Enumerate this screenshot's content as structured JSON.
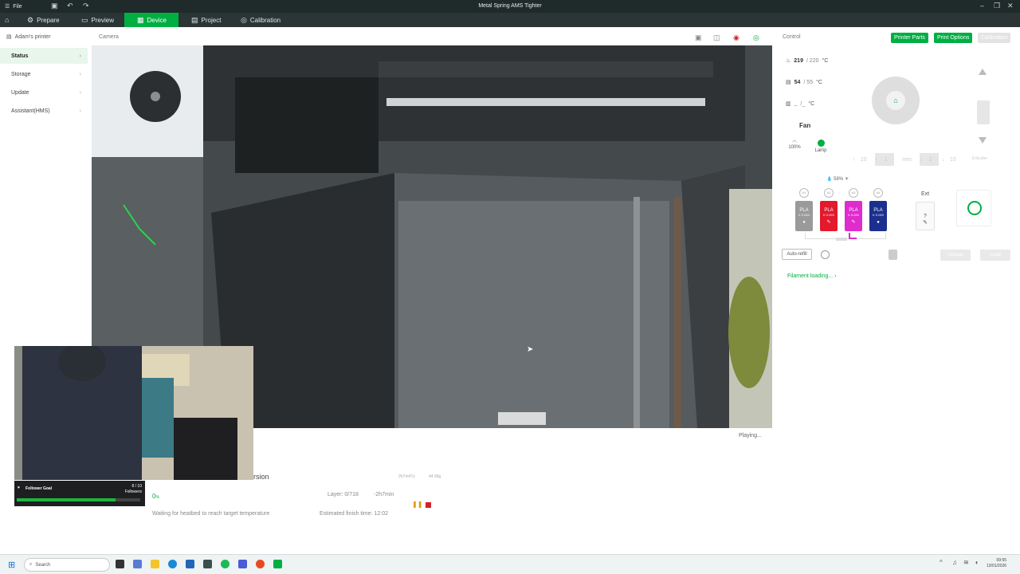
{
  "titlebar": {
    "menu": "File",
    "title": "Metal Spring AMS Tighter"
  },
  "nav": {
    "tabs": [
      {
        "label": "Prepare"
      },
      {
        "label": "Preview"
      },
      {
        "label": "Device"
      },
      {
        "label": "Project"
      },
      {
        "label": "Calibration"
      }
    ]
  },
  "sidebar": {
    "printer_name": "Adam's printer",
    "items": [
      {
        "label": "Status"
      },
      {
        "label": "Storage"
      },
      {
        "label": "Update"
      },
      {
        "label": "Assistant(HMS)"
      }
    ]
  },
  "camera": {
    "label": "Camera",
    "status": "Playing..."
  },
  "overlay": {
    "follower_goal": "Follower Goal",
    "count": "8 / 10",
    "count_label": "Followers",
    "progress": 0.8
  },
  "task": {
    "title_fragment": "rsion",
    "time_meta": "2h7m47s",
    "weight_meta": "44.99g",
    "progress_pct": "0",
    "progress_unit": "%",
    "layer": "Layer: 0/718",
    "remaining": "-2h7min",
    "status": "Waiting for heatbed to reach target temperature",
    "finish": "Estimated finish time: 12:02"
  },
  "control": {
    "label": "Control",
    "buttons": {
      "printer_parts": "Printer Parts",
      "print_options": "Print Options",
      "calibration": "Calibration"
    },
    "nozzle": {
      "value": "219",
      "target": "/ 220",
      "unit": "°C"
    },
    "bed": {
      "value": "54",
      "target": "/ 55",
      "unit": "°C"
    },
    "chamber": {
      "value": "_",
      "target": "/_",
      "unit": "°C"
    },
    "fan_title": "Fan",
    "fan_speed": "100%",
    "lamp": "Lamp",
    "extruder_label": "Extruder",
    "z_steps": [
      "10",
      "1",
      "mm",
      "1",
      "10"
    ],
    "humidity": "58",
    "humidity_unit": "%",
    "ams_slots": [
      {
        "label": "A1",
        "type": "PLA",
        "k": "K 0.020",
        "color": "#9a9a9a"
      },
      {
        "label": "A2",
        "type": "PLA",
        "k": "K 0.020",
        "color": "#e3192c"
      },
      {
        "label": "A3",
        "type": "PLA",
        "k": "K 0.020",
        "color": "#e02bcd"
      },
      {
        "label": "A4",
        "type": "PLA",
        "k": "K 0.020",
        "color": "#1b2f8e"
      }
    ],
    "ext_label": "Ext",
    "ext_value": "?",
    "auto_refill": "Auto-refill",
    "unload": "Unload",
    "load": "Load",
    "filament_loading": "Filament loading..."
  },
  "taskbar": {
    "search": "Search",
    "time": "09:55",
    "date": "13/01/2026"
  },
  "colors": {
    "accent": "#00ae42",
    "nav_bg": "#2b3536",
    "title_bg": "#1f2a2b"
  }
}
